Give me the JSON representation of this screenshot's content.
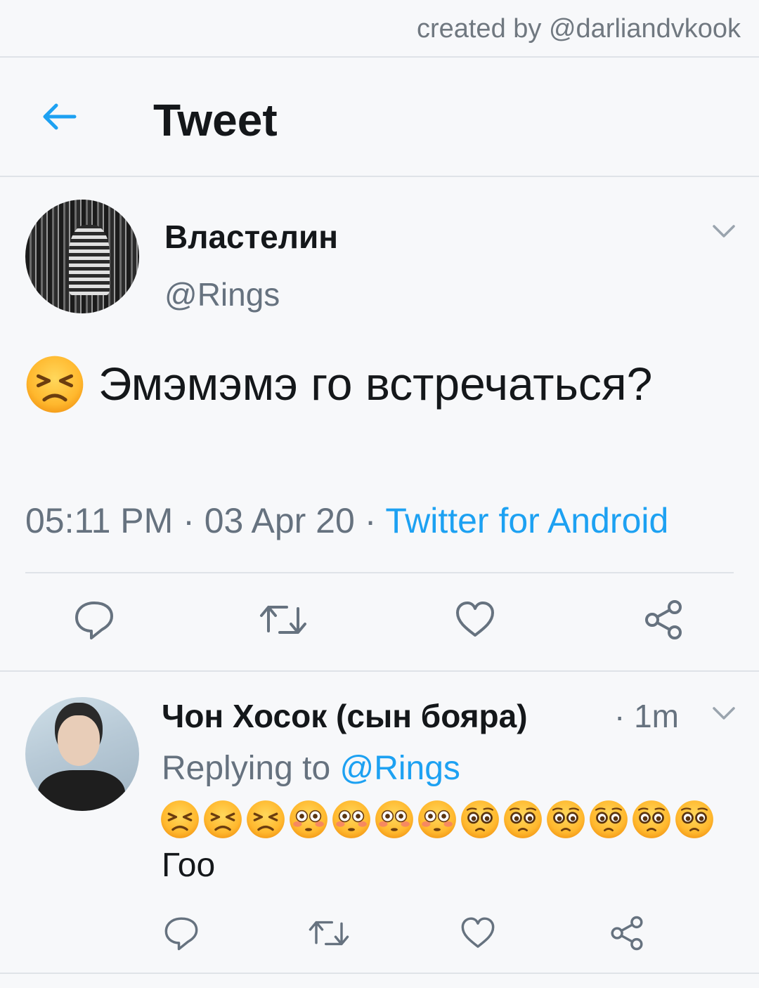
{
  "credit": "created by @darliandvkook",
  "header": {
    "title": "Tweet"
  },
  "tweet": {
    "display_name": "Властелин",
    "handle": "@Rings",
    "text": "Эмэмэмэ го встречаться?",
    "timestamp": "05:11 PM · 03 Apr 20 · ",
    "source": "Twitter for Android"
  },
  "reply": {
    "display_name": "Чон Хосок (сын бояра)",
    "time": "· 1m",
    "replying_prefix": "Replying to ",
    "replying_handle": "@Rings",
    "emojis": [
      "persevering-face",
      "persevering-face",
      "persevering-face",
      "flushed-face",
      "flushed-face",
      "flushed-face",
      "flushed-face",
      "pleading-face",
      "pleading-face",
      "pleading-face",
      "pleading-face",
      "pleading-face",
      "pleading-face"
    ],
    "text": "Гоо"
  },
  "icons": [
    "back-arrow-icon",
    "chevron-down-icon",
    "reply-icon",
    "retweet-icon",
    "like-icon",
    "share-icon"
  ],
  "colors": {
    "accent": "#1da1f2",
    "muted": "#66727f",
    "divider": "#dfe3e8",
    "emoji_face": "#ffb82e"
  }
}
